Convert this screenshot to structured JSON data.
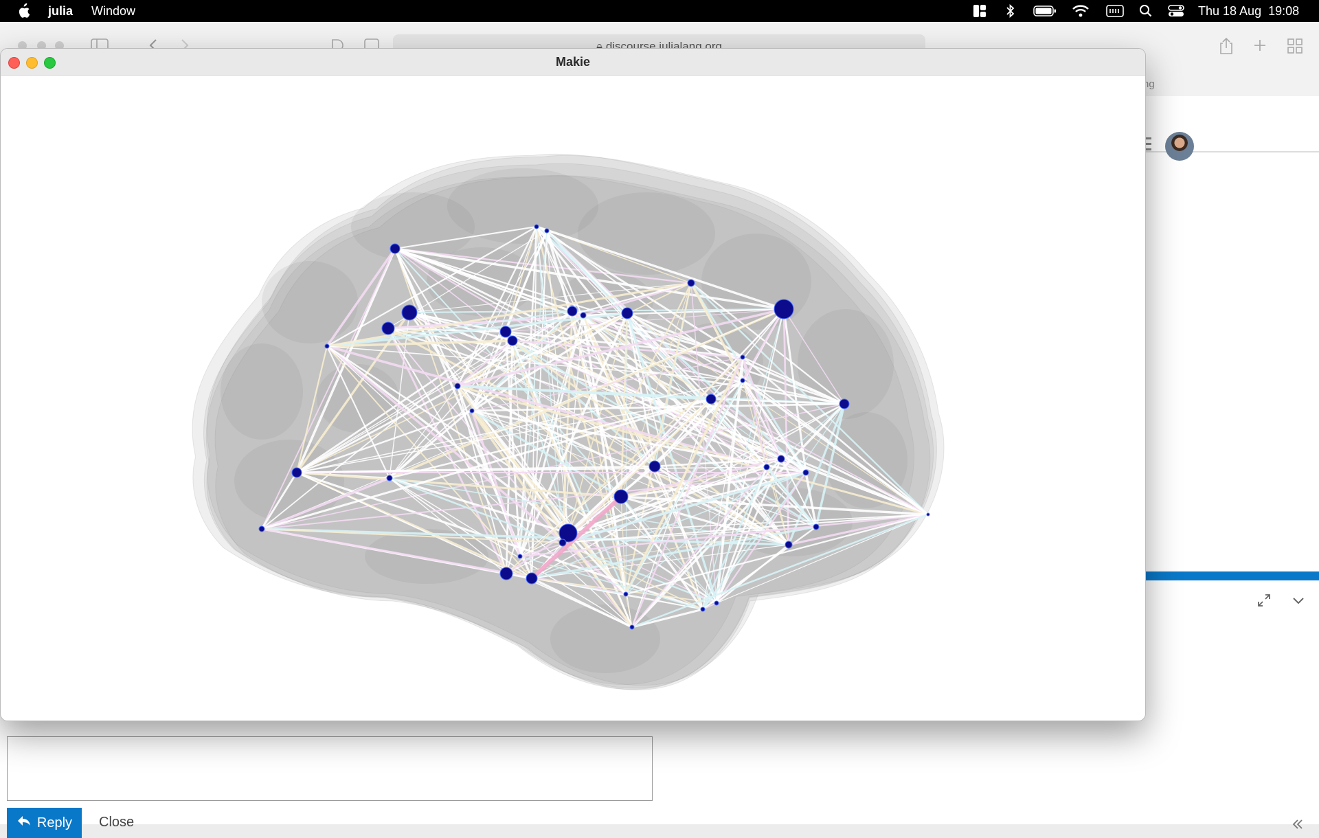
{
  "menubar": {
    "app_name": "julia",
    "menu_window": "Window",
    "clock": "Thu 18 Aug  19:08",
    "icons": [
      "apple-icon",
      "layout-icon",
      "bluetooth-icon",
      "battery-icon",
      "wifi-icon",
      "keyboard-icon",
      "search-icon",
      "control-center-icon"
    ]
  },
  "browser": {
    "url": "discourse.julialang.org",
    "tab_fragment": "ng",
    "accent": "#0a78c8"
  },
  "composer": {
    "reply_label": "Reply",
    "close_label": "Close"
  },
  "makie": {
    "title": "Makie",
    "node_color": "#0b0b8c",
    "edge_color": "#ffffff",
    "brain_color": "#9a9a9a"
  }
}
